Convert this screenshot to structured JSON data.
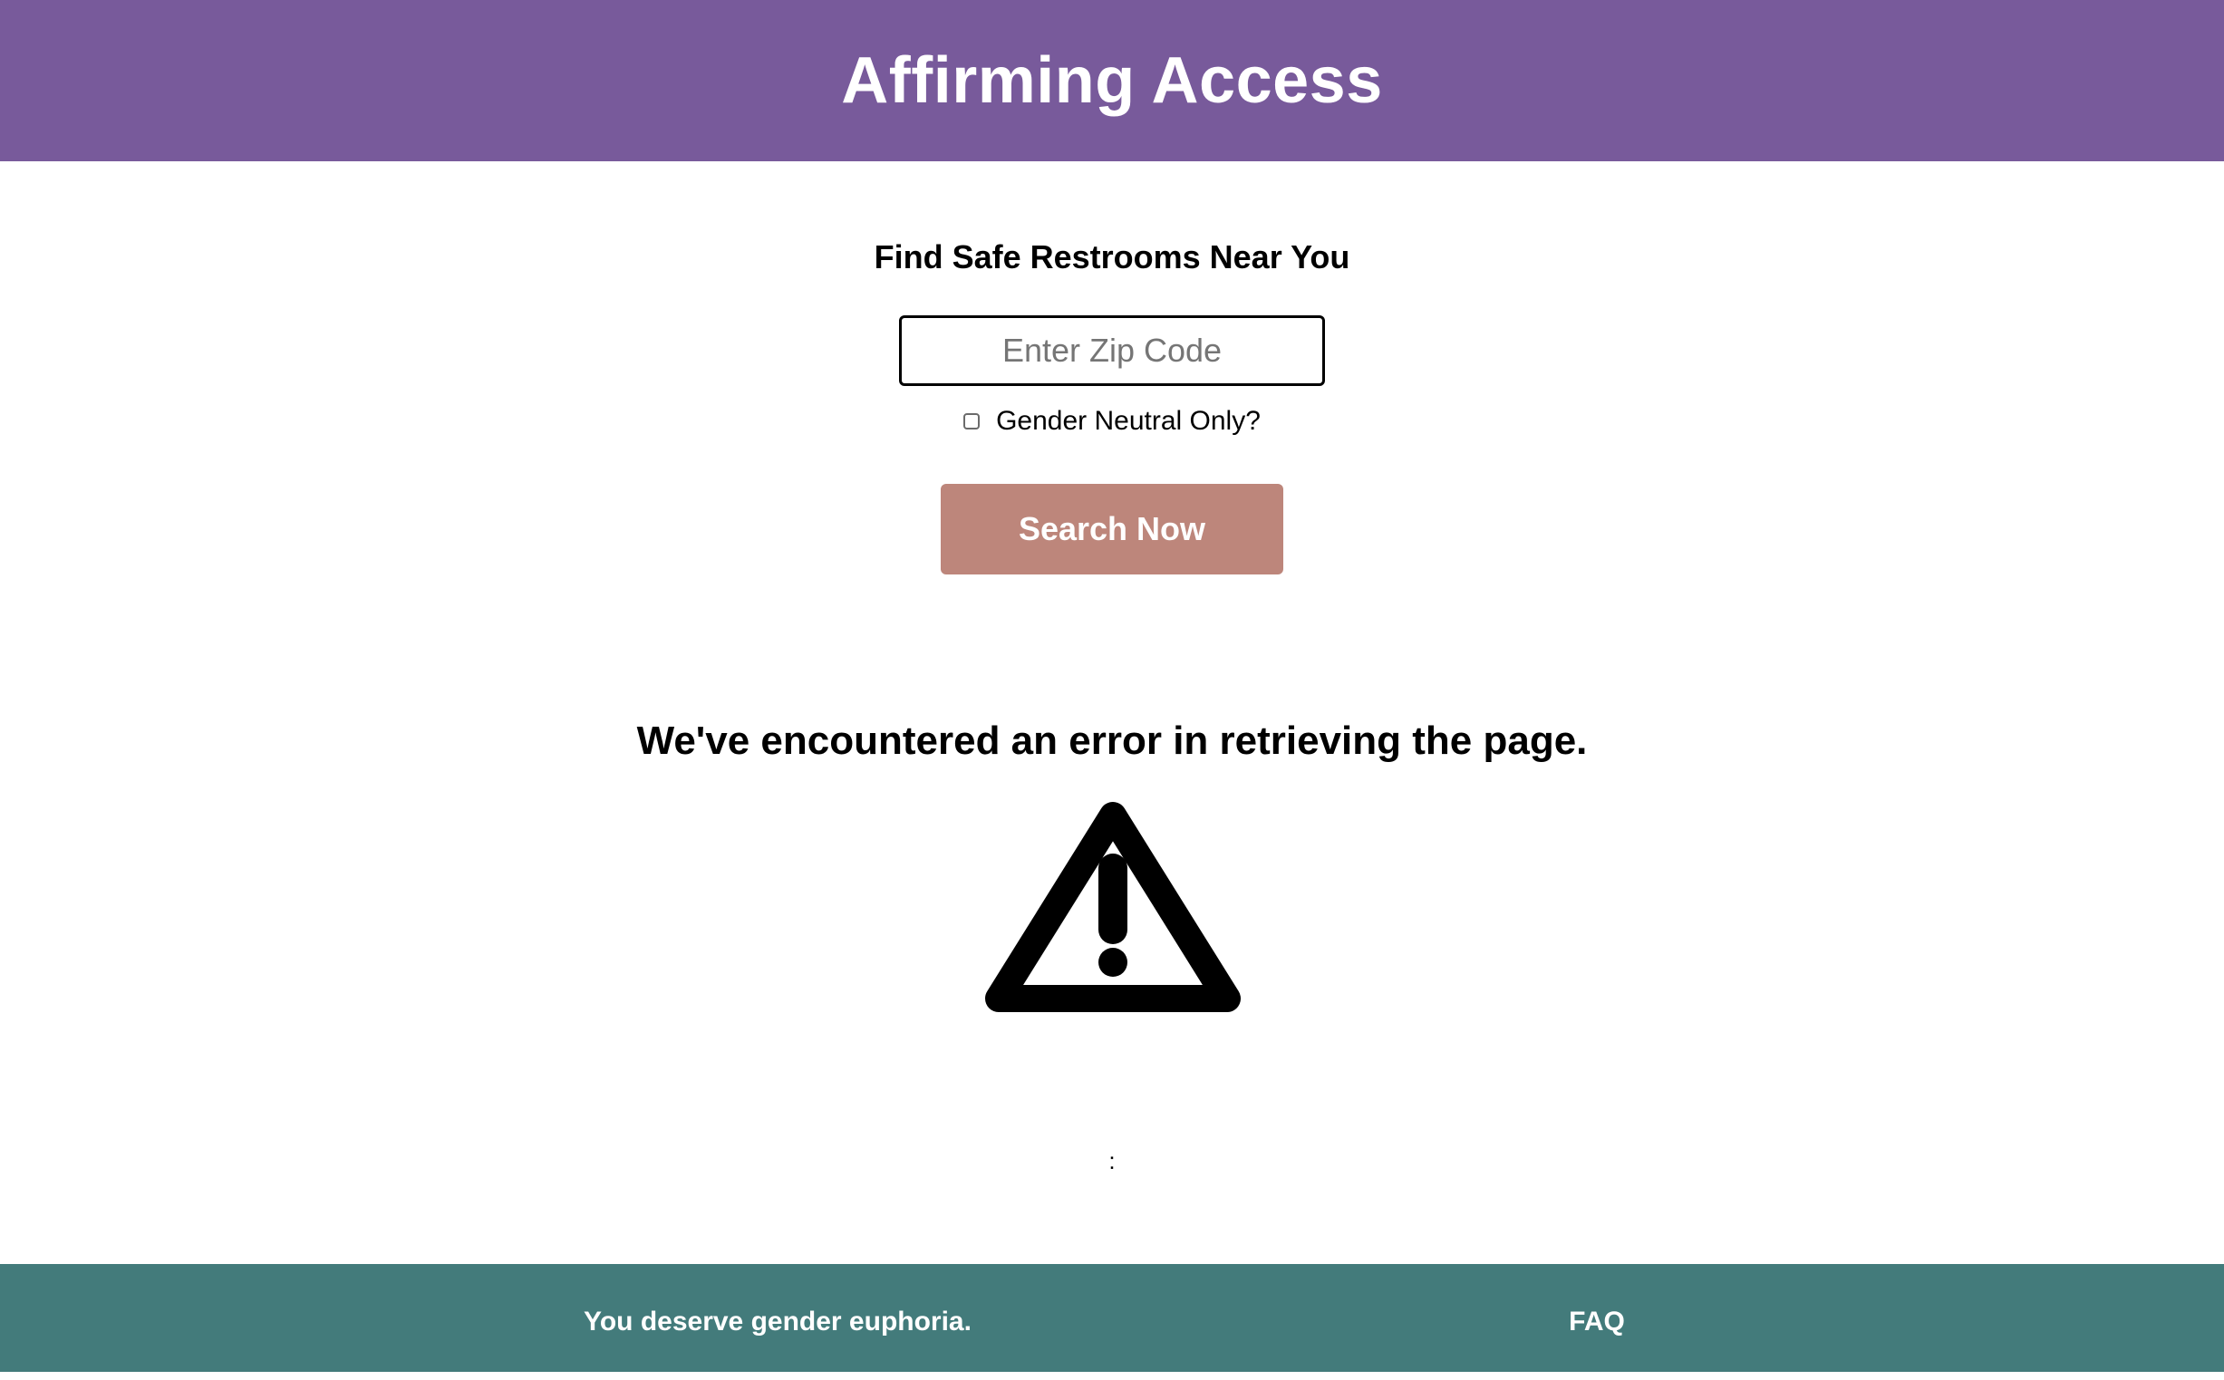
{
  "header": {
    "title": "Affirming Access",
    "background_color": "#785a9b"
  },
  "search": {
    "title": "Find Safe Restrooms Near You",
    "zip_placeholder": "Enter Zip Code",
    "zip_value": "",
    "gender_neutral_label": "Gender Neutral Only?",
    "gender_neutral_checked": false,
    "button_label": "Search Now",
    "button_color": "#bd867b"
  },
  "error": {
    "message": "We've encountered an error in retrieving the page.",
    "icon": "warning-icon",
    "detail": ":"
  },
  "footer": {
    "tagline": "You deserve gender euphoria.",
    "faq_label": "FAQ",
    "background_color": "#437b7b"
  }
}
